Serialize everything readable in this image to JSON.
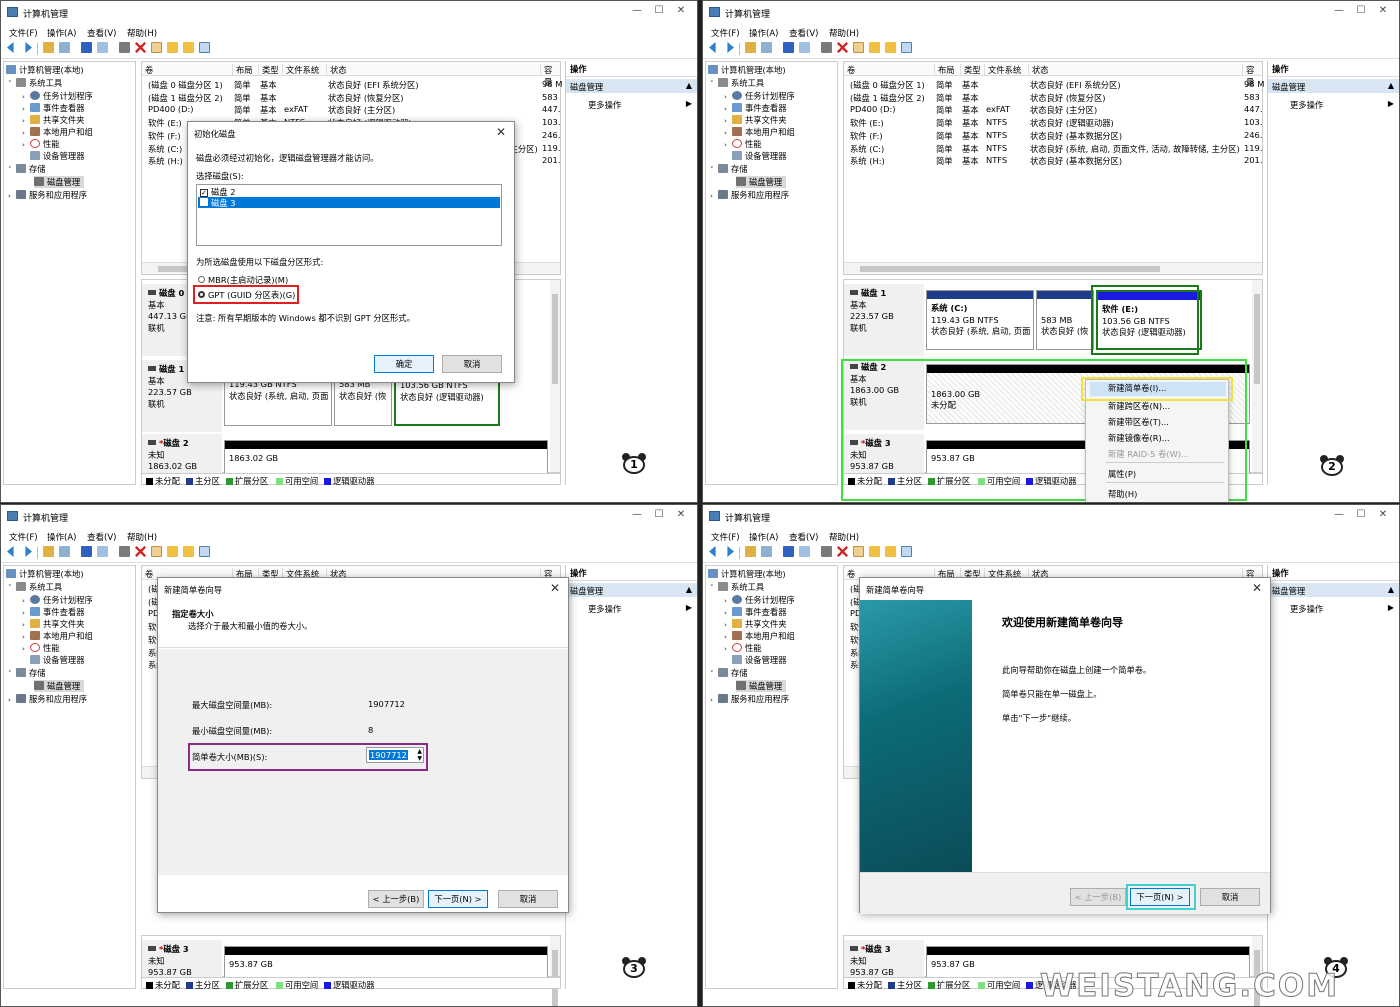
{
  "window": {
    "title": "计算机管理",
    "min": "—",
    "max": "☐",
    "close": "✕"
  },
  "menu": [
    "文件(F)",
    "操作(A)",
    "查看(V)",
    "帮助(H)"
  ],
  "tree": {
    "root": "计算机管理(本地)",
    "system_tools": "系统工具",
    "task_scheduler": "任务计划程序",
    "event_viewer": "事件查看器",
    "shared_folders": "共享文件夹",
    "local_users": "本地用户和组",
    "performance": "性能",
    "device_manager": "设备管理器",
    "storage": "存储",
    "disk_management": "磁盘管理",
    "services": "服务和应用程序"
  },
  "columns": [
    "卷",
    "布局",
    "类型",
    "文件系统",
    "状态",
    "容量"
  ],
  "volumes": [
    [
      "(磁盘 0 磁盘分区 1)",
      "简单",
      "基本",
      "",
      "状态良好 (EFI 系统分区)",
      "98 M"
    ],
    [
      "(磁盘 1 磁盘分区 2)",
      "简单",
      "基本",
      "",
      "状态良好 (恢复分区)",
      "583"
    ],
    [
      "PD400 (D:)",
      "简单",
      "基本",
      "exFAT",
      "状态良好 (主分区)",
      "447."
    ],
    [
      "软件 (E:)",
      "简单",
      "基本",
      "NTFS",
      "状态良好 (逻辑驱动器)",
      "103."
    ],
    [
      "软件 (F:)",
      "简单",
      "基本",
      "NTFS",
      "状态良好 (基本数据分区)",
      "246."
    ],
    [
      "系统 (C:)",
      "简单",
      "基本",
      "NTFS",
      "状态良好 (系统, 启动, 页面文件, 活动, 故障转储, 主分区)",
      "119."
    ],
    [
      "系统 (H:)",
      "简单",
      "基本",
      "NTFS",
      "状态良好 (基本数据分区)",
      "201."
    ]
  ],
  "p1_vol_clipped": [
    "(磁盘 0 磁盘分区 1)",
    "(磁盘 1 磁盘分区 2)",
    "PD400 (D:)",
    "软件 (E:)",
    "软件 (F:)",
    "系统 (C:)",
    "系统 (H:)"
  ],
  "disks": {
    "d0": {
      "name": "磁盘 0",
      "type": "基本",
      "size": "447.13 GB",
      "state": "联机"
    },
    "d1": {
      "name": "磁盘 1",
      "type": "基本",
      "size": "223.57 GB",
      "state": "联机",
      "p_c_name": "系统 (C:)",
      "p_c_size": "119.43 GB NTFS",
      "p_c_status": "状态良好 (系统, 启动, 页面",
      "p_r_size": "583 MB",
      "p_r_status": "状态良好 (恢",
      "p_e_name": "软件 (E:)",
      "p_e_size": "103.56 GB NTFS",
      "p_e_status": "状态良好 (逻辑驱动器)"
    },
    "d2_unknown": {
      "name": "磁盘 2",
      "type": "未知",
      "size": "1863.02 GB",
      "state": "",
      "part": "1863.02 GB"
    },
    "d2_basic": {
      "name": "磁盘 2",
      "type": "基本",
      "size": "1863.00 GB",
      "state": "联机",
      "part": "1863.00 GB",
      "part_state": "未分配"
    },
    "d3": {
      "name": "磁盘 3",
      "type": "未知",
      "size": "953.87 GB",
      "part": "953.87 GB"
    }
  },
  "legend": [
    "未分配",
    "主分区",
    "扩展分区",
    "可用空间",
    "逻辑驱动器"
  ],
  "actions": {
    "header": "操作",
    "section": "磁盘管理",
    "more": "更多操作"
  },
  "init_dialog": {
    "title": "初始化磁盘",
    "desc": "磁盘必须经过初始化，逻辑磁盘管理器才能访问。",
    "select_label": "选择磁盘(S):",
    "disk_items": [
      "磁盘 2",
      "磁盘 3"
    ],
    "style_label": "为所选磁盘使用以下磁盘分区形式:",
    "mbr": "MBR(主启动记录)(M)",
    "gpt": "GPT (GUID 分区表)(G)",
    "note": "注意: 所有早期版本的 Windows 都不识别 GPT 分区形式。",
    "ok": "确定",
    "cancel": "取消"
  },
  "context_menu": [
    "新建简单卷(I)...",
    "新建跨区卷(N)...",
    "新建带区卷(T)...",
    "新建镜像卷(R)...",
    "新建 RAID-5 卷(W)...",
    "属性(P)",
    "帮助(H)"
  ],
  "size_dialog": {
    "title": "新建简单卷向导",
    "heading": "指定卷大小",
    "sub": "选择介于最大和最小值的卷大小。",
    "max_label": "最大磁盘空间量(MB):",
    "max_value": "1907712",
    "min_label": "最小磁盘空间量(MB):",
    "min_value": "8",
    "size_label": "简单卷大小(MB)(S):",
    "size_value": "1907712",
    "back": "< 上一步(B)",
    "next": "下一页(N) >",
    "cancel": "取消"
  },
  "welcome_dialog": {
    "title": "新建简单卷向导",
    "heading": "欢迎使用新建简单卷向导",
    "line1": "此向导帮助你在磁盘上创建一个简单卷。",
    "line2": "简单卷只能在单一磁盘上。",
    "line3": "单击\"下一步\"继续。",
    "back": "< 上一步(B)",
    "next": "下一页(N) >",
    "cancel": "取消"
  },
  "badges": [
    "1",
    "2",
    "3",
    "4"
  ],
  "watermark": "WEISTANG.COM",
  "colors": {
    "primary_part": "#1f3c8c",
    "logical": "#1a1ae0",
    "extended": "#2e9a2e",
    "free": "#7fe07f",
    "highlight_red": "#e02020",
    "highlight_yellow": "#f0e040",
    "highlight_green": "#40e040",
    "highlight_purple": "#8a2a8a",
    "highlight_cyan": "#40d0d0"
  }
}
